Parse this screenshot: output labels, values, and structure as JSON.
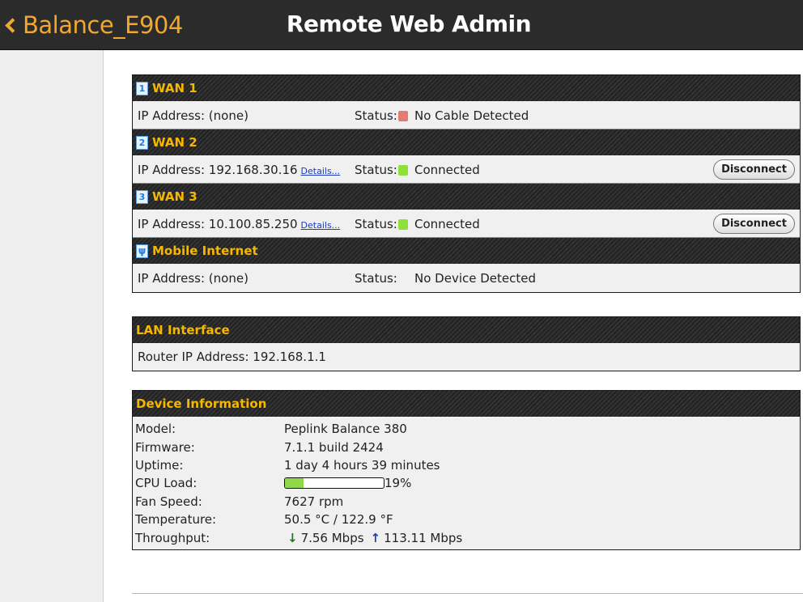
{
  "header": {
    "back_label": "Balance_E904",
    "title": "Remote Web Admin"
  },
  "wan": [
    {
      "num": "1",
      "name": "WAN 1",
      "ip_text": "IP Address: (none)",
      "details": "",
      "status_label": "Status:",
      "status": "No Cable Detected",
      "status_color": "#e27c70",
      "button": ""
    },
    {
      "num": "2",
      "name": "WAN 2",
      "ip_text": "IP Address: 192.168.30.16",
      "details": "Details...",
      "status_label": "Status:",
      "status": "Connected",
      "status_color": "#8fe03a",
      "button": "Disconnect"
    },
    {
      "num": "3",
      "name": "WAN 3",
      "ip_text": "IP Address: 10.100.85.250",
      "details": "Details...",
      "status_label": "Status:",
      "status": "Connected",
      "status_color": "#8fe03a",
      "button": "Disconnect"
    }
  ],
  "mobile": {
    "name": "Mobile Internet",
    "ip_text": "IP Address: (none)",
    "status_label": "Status:",
    "status": "No Device Detected"
  },
  "lan": {
    "title": "LAN Interface",
    "router_ip": "Router IP Address: 192.168.1.1"
  },
  "device": {
    "title": "Device Information",
    "model_label": "Model:",
    "model": "Peplink Balance 380",
    "firmware_label": "Firmware:",
    "firmware": "7.1.1 build 2424",
    "uptime_label": "Uptime:",
    "uptime": "1 day 4 hours 39 minutes",
    "cpu_label": "CPU Load:",
    "cpu_percent": 19,
    "cpu_text": "19%",
    "fan_label": "Fan Speed:",
    "fan": "7627 rpm",
    "temp_label": "Temperature:",
    "temp": "50.5 °C / 122.9 °F",
    "throughput_label": "Throughput:",
    "down_arrow": "↓",
    "down": "7.56 Mbps",
    "up_arrow": "↑",
    "up": "113.11 Mbps"
  },
  "icons": {
    "usb": "usb-icon"
  }
}
